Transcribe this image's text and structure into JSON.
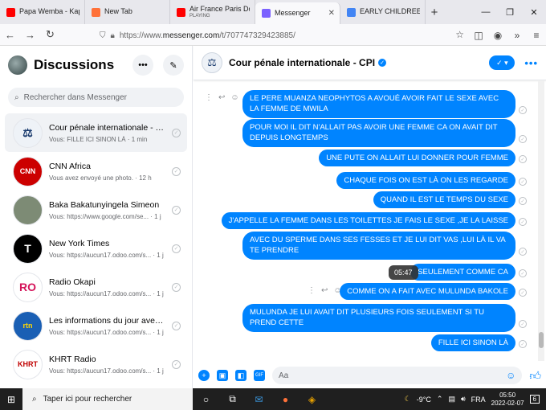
{
  "browser": {
    "tabs": [
      {
        "title": "Papa Wemba - Kap",
        "color": "#ff0000",
        "active": false
      },
      {
        "title": "New Tab",
        "color": "#ff7139",
        "active": false
      },
      {
        "title": "Air France Paris Do",
        "subtitle": "PLAYING",
        "color": "#ff0000",
        "active": false
      },
      {
        "title": "Messenger",
        "color": "#7b61ff",
        "active": true
      },
      {
        "title": "EARLY CHILDREEN",
        "color": "#4285f4",
        "active": false
      }
    ],
    "url_prefix": "https://www.",
    "url_host": "messenger.com",
    "url_path": "/t/707747329423885/"
  },
  "sidebar": {
    "title": "Discussions",
    "search_placeholder": "Rechercher dans Messenger",
    "conversations": [
      {
        "name": "Cour pénale internationale - CPI",
        "snippet": "Vous: FILLE ICI SINON LÀ · 1 min",
        "avatar_bg": "#eef2f7",
        "avatar_text": "⚖",
        "avatar_color": "#1a3b6e",
        "active": true
      },
      {
        "name": "CNN Africa",
        "snippet": "Vous avez envoyé une photo. · 12 h",
        "avatar_bg": "#cc0000",
        "avatar_text": "CNN",
        "avatar_color": "#ffffff",
        "active": false
      },
      {
        "name": "Baka Bakatunyingela Simeon",
        "snippet": "Vous: https://www.google.com/se... · 1 j",
        "avatar_bg": "#7d8b75",
        "avatar_text": "",
        "avatar_color": "#ffffff",
        "active": false
      },
      {
        "name": "New York Times",
        "snippet": "Vous: https://aucun17.odoo.com/s... · 1 j",
        "avatar_bg": "#000000",
        "avatar_text": "T",
        "avatar_color": "#ffffff",
        "active": false
      },
      {
        "name": "Radio Okapi",
        "snippet": "Vous: https://aucun17.odoo.com/s... · 1 j",
        "avatar_bg": "#ffffff",
        "avatar_text": "RO",
        "avatar_color": "#d4145a",
        "active": false
      },
      {
        "name": "Les informations du jour avec rtn...",
        "snippet": "Vous: https://aucun17.odoo.com/s... · 1 j",
        "avatar_bg": "#1a5fb4",
        "avatar_text": "rtn",
        "avatar_color": "#ffd700",
        "active": false
      },
      {
        "name": "KHRT Radio",
        "snippet": "Vous: https://aucun17.odoo.com/s... · 1 j",
        "avatar_bg": "#ffffff",
        "avatar_text": "KHRT",
        "avatar_color": "#c00000",
        "active": false
      }
    ]
  },
  "chat": {
    "title": "Cour pénale internationale - CPI",
    "tooltip": "05:47",
    "composer_placeholder": "Aa",
    "messages": [
      "LE PERE MUANZA NEOPHYTOS A AVOUÉ AVOIR FAIT LE SEXE AVEC LA FEMME DE MWILA",
      "POUR MOI IL DIT N'ALLAIT PAS AVOIR UNE FEMME CA ON AVAIT DIT DEPUIS LONGTEMPS",
      "UNE PUTE ON ALLAIT LUI DONNER POUR FEMME",
      "CHAQUE FOIS ON EST LÀ ON LES REGARDE",
      "QUAND IL EST LE TEMPS DU SEXE",
      "J'APPELLE LA FEMME DANS LES TOILETTES JE FAIS LE SEXE ,JE LA LAISSE",
      "AVEC DU SPERME DANS SES FESSES ET JE LUI DIT VAS ,LUI LÀ IL VA TE PRENDRE",
      "SEULEMENT COMME CA",
      "COMME ON A FAIT AVEC MULUNDA BAKOLE",
      "MULUNDA JE LUI AVAIT DIT PLUSIEURS FOIS SEULEMENT SI TU PREND CETTE",
      "FILLE ICI SINON LÀ"
    ]
  },
  "taskbar": {
    "search_placeholder": "Taper ici pour rechercher",
    "temperature": "-9°C",
    "language": "FRA",
    "time": "05:50",
    "date": "2022-02-07",
    "notification_count": "6"
  }
}
